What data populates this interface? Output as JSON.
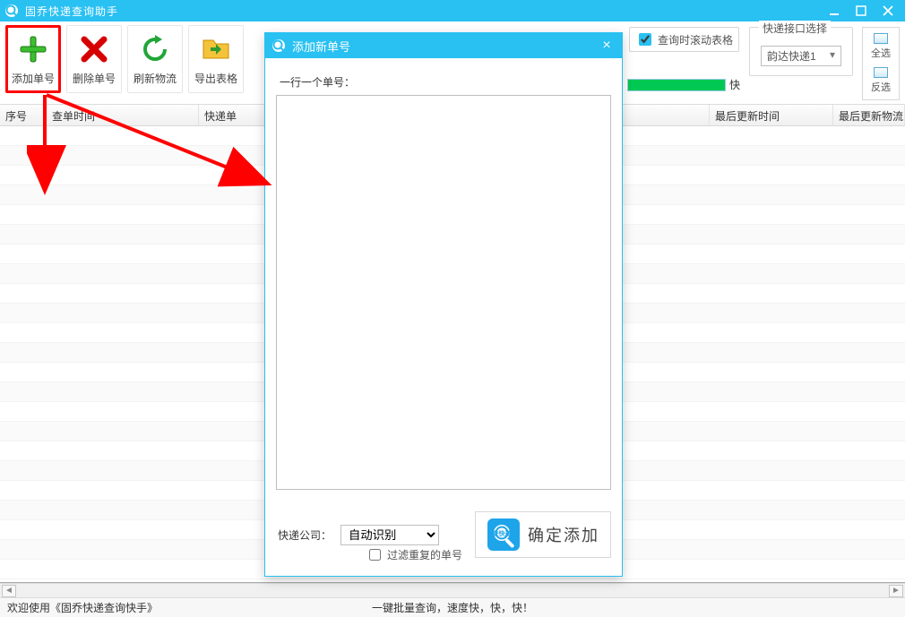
{
  "window": {
    "title": "固乔快递查询助手"
  },
  "toolbar": {
    "add_label": "添加单号",
    "del_label": "删除单号",
    "refresh_label": "刷新物流",
    "export_label": "导出表格"
  },
  "options": {
    "scroll_on_query_label": "查询时滚动表格",
    "progress_suffix": "快",
    "interface_group_label": "快递接口选择",
    "interface_selected": "韵达快递1",
    "select_all_label": "全选",
    "invert_sel_label": "反选"
  },
  "columns": {
    "seq": "序号",
    "check_time": "查单时间",
    "track_no": "快递单",
    "last_update": "最后更新时间",
    "last_logistics": "最后更新物流"
  },
  "statusbar": {
    "left": "欢迎使用《固乔快递查询快手》",
    "mid": "一键批量查询，速度快，快，快！"
  },
  "dialog": {
    "title": "添加新单号",
    "prompt": "一行一个单号：",
    "company_label": "快递公司：",
    "company_selected": "自动识别",
    "dedupe_label": "过滤重复的单号",
    "confirm_label": "确定添加",
    "confirm_icon_text": "查快递"
  }
}
